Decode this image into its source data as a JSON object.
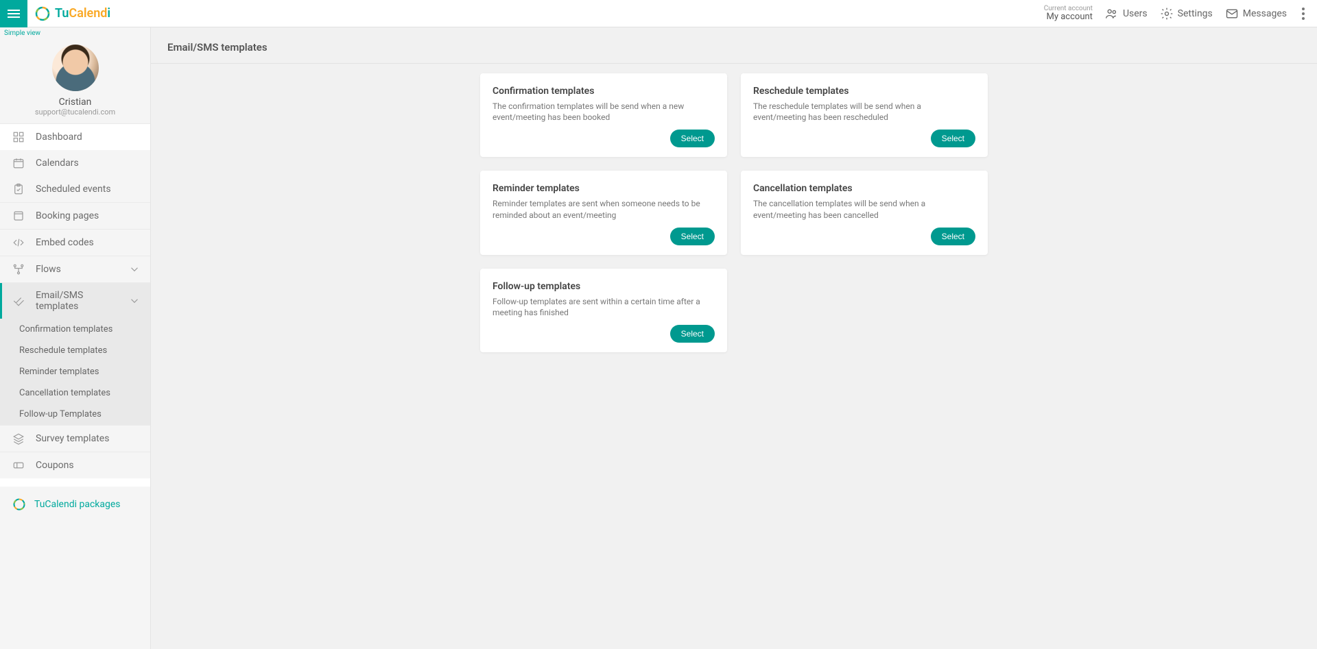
{
  "brand": {
    "part1": "Tu",
    "part2": "Calend",
    "part3": "i"
  },
  "header": {
    "currentAccountLabel": "Current account",
    "accountName": "My account",
    "usersLabel": "Users",
    "settingsLabel": "Settings",
    "messagesLabel": "Messages"
  },
  "sidebar": {
    "simpleView": "Simple view",
    "profile": {
      "name": "Cristian",
      "email": "support@tucalendi.com"
    },
    "items": {
      "dashboard": "Dashboard",
      "calendars": "Calendars",
      "scheduled": "Scheduled events",
      "booking": "Booking pages",
      "embed": "Embed codes",
      "flows": "Flows",
      "templates": "Email/SMS templates",
      "survey": "Survey templates",
      "coupons": "Coupons",
      "packages": "TuCalendi packages"
    },
    "sub": {
      "confirmation": "Confirmation templates",
      "reschedule": "Reschedule templates",
      "reminder": "Reminder templates",
      "cancellation": "Cancellation templates",
      "followup": "Follow-up Templates"
    }
  },
  "page": {
    "title": "Email/SMS templates"
  },
  "cards": {
    "confirmation": {
      "title": "Confirmation templates",
      "desc": "The confirmation templates will be send when a new event/meeting has been booked",
      "button": "Select"
    },
    "reschedule": {
      "title": "Reschedule templates",
      "desc": "The reschedule templates will be send when a event/meeting has been rescheduled",
      "button": "Select"
    },
    "reminder": {
      "title": "Reminder templates",
      "desc": "Reminder templates are sent when someone needs to be reminded about an event/meeting",
      "button": "Select"
    },
    "cancellation": {
      "title": "Cancellation templates",
      "desc": "The cancellation templates will be send when a event/meeting has been cancelled",
      "button": "Select"
    },
    "followup": {
      "title": "Follow-up templates",
      "desc": "Follow-up templates are sent within a certain time after a meeting has finished",
      "button": "Select"
    }
  }
}
